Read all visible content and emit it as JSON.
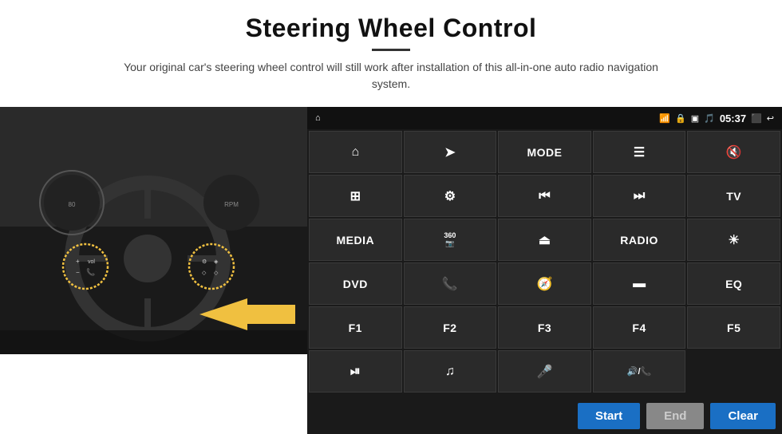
{
  "page": {
    "title": "Steering Wheel Control",
    "subtitle": "Your original car's steering wheel control will still work after installation of this all-in-one auto radio navigation system.",
    "divider_color": "#333"
  },
  "status_bar": {
    "time": "05:37",
    "icons": [
      "wifi",
      "lock",
      "sim",
      "bluetooth",
      "screen",
      "back"
    ]
  },
  "buttons": [
    {
      "id": "home",
      "type": "icon",
      "icon": "⌂",
      "row": 1,
      "col": 1
    },
    {
      "id": "nav",
      "type": "icon",
      "icon": "➤",
      "row": 1,
      "col": 2
    },
    {
      "id": "mode",
      "type": "text",
      "label": "MODE",
      "row": 1,
      "col": 3
    },
    {
      "id": "list",
      "type": "icon",
      "icon": "☰",
      "row": 1,
      "col": 4
    },
    {
      "id": "mute",
      "type": "icon",
      "icon": "🔇",
      "row": 1,
      "col": 5
    },
    {
      "id": "apps",
      "type": "icon",
      "icon": "⊞",
      "row": 1,
      "col": 6
    },
    {
      "id": "settings",
      "type": "icon",
      "icon": "⚙",
      "row": 2,
      "col": 1
    },
    {
      "id": "prev",
      "type": "icon",
      "icon": "⏮",
      "row": 2,
      "col": 2
    },
    {
      "id": "next",
      "type": "icon",
      "icon": "⏭",
      "row": 2,
      "col": 3
    },
    {
      "id": "tv",
      "type": "text",
      "label": "TV",
      "row": 2,
      "col": 4
    },
    {
      "id": "media",
      "type": "text",
      "label": "MEDIA",
      "row": 2,
      "col": 5
    },
    {
      "id": "cam360",
      "type": "icon",
      "icon": "📷",
      "row": 3,
      "col": 1
    },
    {
      "id": "eject",
      "type": "icon",
      "icon": "⏏",
      "row": 3,
      "col": 2
    },
    {
      "id": "radio",
      "type": "text",
      "label": "RADIO",
      "row": 3,
      "col": 3
    },
    {
      "id": "brightness",
      "type": "icon",
      "icon": "☀",
      "row": 3,
      "col": 4
    },
    {
      "id": "dvd",
      "type": "text",
      "label": "DVD",
      "row": 3,
      "col": 5
    },
    {
      "id": "phone",
      "type": "icon",
      "icon": "📞",
      "row": 4,
      "col": 1
    },
    {
      "id": "navi",
      "type": "icon",
      "icon": "🧭",
      "row": 4,
      "col": 2
    },
    {
      "id": "screen2",
      "type": "icon",
      "icon": "▬",
      "row": 4,
      "col": 3
    },
    {
      "id": "eq",
      "type": "text",
      "label": "EQ",
      "row": 4,
      "col": 4
    },
    {
      "id": "f1",
      "type": "text",
      "label": "F1",
      "row": 4,
      "col": 5
    },
    {
      "id": "f2",
      "type": "text",
      "label": "F2",
      "row": 5,
      "col": 1
    },
    {
      "id": "f3",
      "type": "text",
      "label": "F3",
      "row": 5,
      "col": 2
    },
    {
      "id": "f4",
      "type": "text",
      "label": "F4",
      "row": 5,
      "col": 3
    },
    {
      "id": "f5",
      "type": "text",
      "label": "F5",
      "row": 5,
      "col": 4
    },
    {
      "id": "playpause",
      "type": "icon",
      "icon": "⏯",
      "row": 5,
      "col": 5
    },
    {
      "id": "music",
      "type": "icon",
      "icon": "♫",
      "row": 6,
      "col": 1
    },
    {
      "id": "mic",
      "type": "icon",
      "icon": "🎤",
      "row": 6,
      "col": 2
    },
    {
      "id": "volphone",
      "type": "icon",
      "icon": "📲",
      "row": 6,
      "col": 3
    }
  ],
  "action_bar": {
    "start_label": "Start",
    "end_label": "End",
    "clear_label": "Clear"
  }
}
